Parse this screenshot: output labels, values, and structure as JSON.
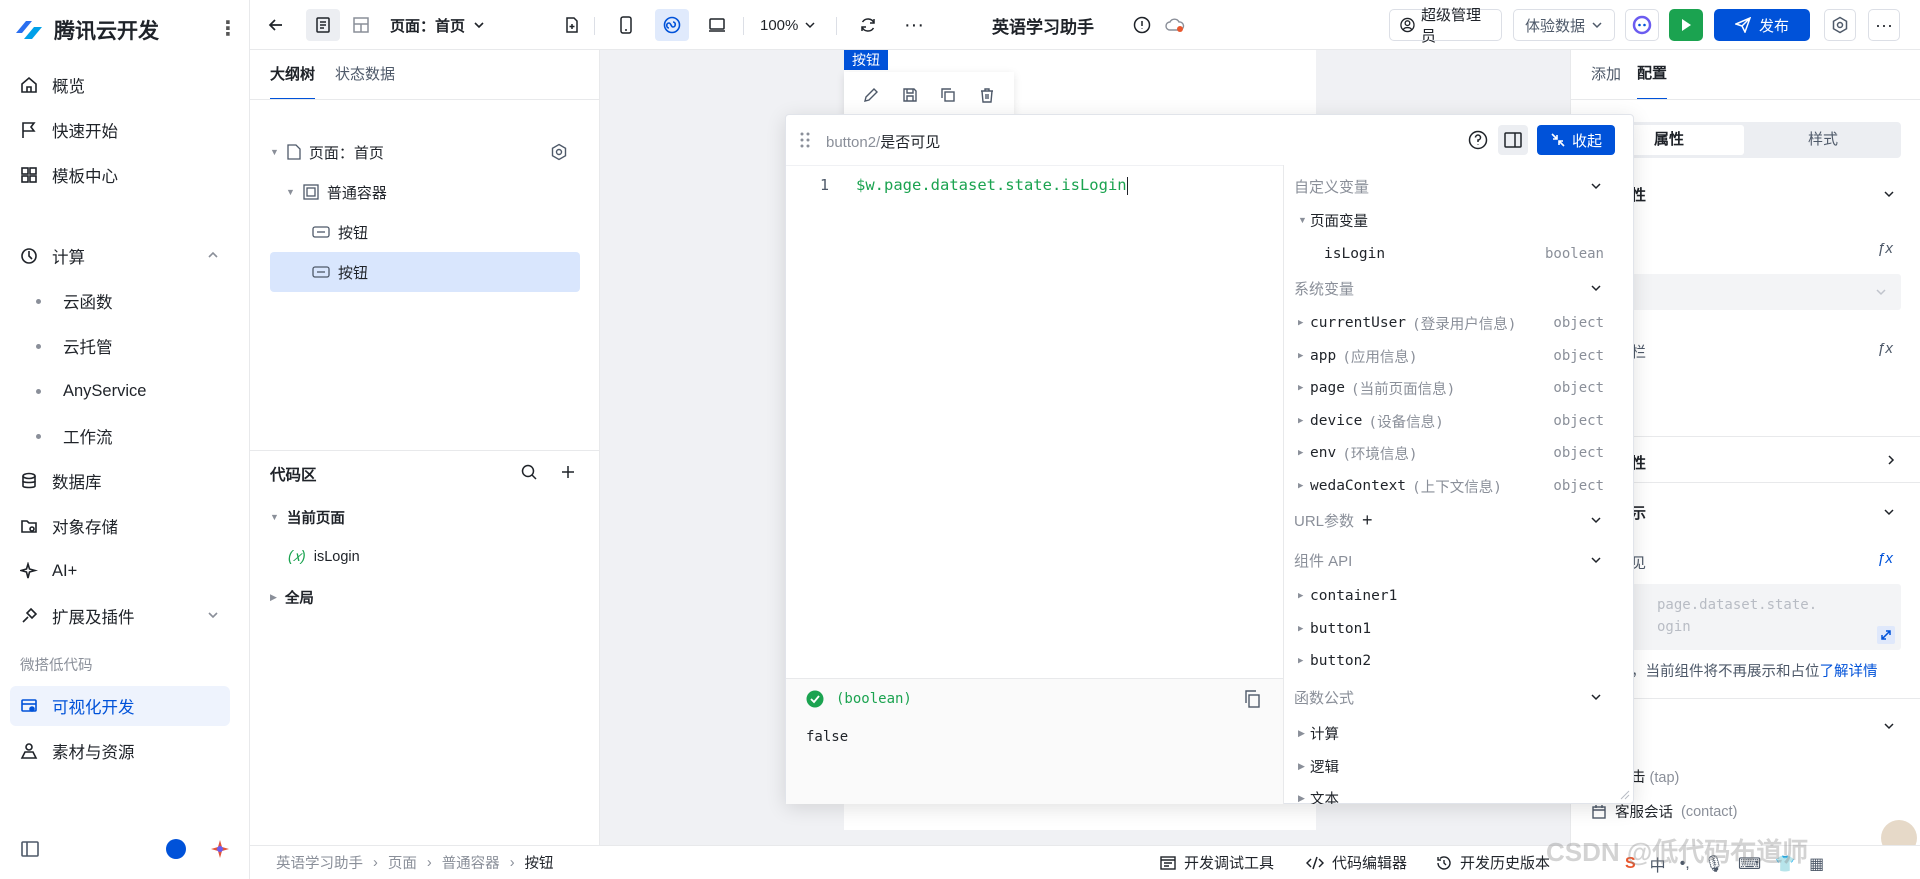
{
  "sidebar": {
    "brand": "腾讯云开发",
    "items": [
      {
        "label": "概览"
      },
      {
        "label": "快速开始"
      },
      {
        "label": "模板中心"
      },
      {
        "label": "计算"
      },
      {
        "label": "云函数"
      },
      {
        "label": "云托管"
      },
      {
        "label": "AnyService"
      },
      {
        "label": "工作流"
      },
      {
        "label": "数据库"
      },
      {
        "label": "对象存储"
      },
      {
        "label": "AI+"
      },
      {
        "label": "扩展及插件"
      }
    ],
    "group_label": "微搭低代码",
    "lowcode_items": [
      {
        "label": "可视化开发"
      },
      {
        "label": "素材与资源"
      }
    ]
  },
  "topbar": {
    "page_label": "页面：首页",
    "zoom": "100%",
    "app_title": "英语学习助手",
    "admin": "超级管理员",
    "data_mode": "体验数据",
    "publish": "发布"
  },
  "outline": {
    "tabs": [
      "大纲树",
      "状态数据"
    ],
    "tree": [
      "页面：首页",
      "普通容器",
      "按钮",
      "按钮"
    ]
  },
  "codearea": {
    "title": "代码区",
    "current_page": "当前页面",
    "var_icon": "(𝑥)",
    "var_name": "isLogin",
    "global": "全局"
  },
  "canvas": {
    "component_tag": "按钮"
  },
  "popup": {
    "path_prefix": "button2/",
    "path_name": "是否可见",
    "collapse": "收起",
    "line_no": "1",
    "code": "$w.page.dataset.state.isLogin",
    "result_type": "(boolean)",
    "result_value": "false",
    "sections": {
      "custom_vars": "自定义变量",
      "page_vars": "页面变量",
      "system_vars": "系统变量",
      "url_params": "URL参数",
      "component_api": "组件 API",
      "functions": "函数公式"
    },
    "page_var": {
      "name": "isLogin",
      "type": "boolean"
    },
    "system_vars": [
      {
        "name": "currentUser",
        "cn": "(登录用户信息)",
        "type": "object"
      },
      {
        "name": "app",
        "cn": "(应用信息)",
        "type": "object"
      },
      {
        "name": "page",
        "cn": "(当前页面信息)",
        "type": "object"
      },
      {
        "name": "device",
        "cn": "(设备信息)",
        "type": "object"
      },
      {
        "name": "env",
        "cn": "(环境信息)",
        "type": "object"
      },
      {
        "name": "wedaContext",
        "cn": "(上下文信息)",
        "type": "object"
      }
    ],
    "components": [
      "container1",
      "button1",
      "button2"
    ],
    "functions": [
      "计算",
      "逻辑",
      "文本"
    ]
  },
  "rightpanel": {
    "tabs": [
      "添加",
      "配置"
    ],
    "seg": [
      "属性",
      "样式"
    ],
    "sec1": "性",
    "row_lan": "栏",
    "sec2": "性",
    "sec3": "示",
    "visible": "见",
    "code_preview": "page.dataset.state.\nogin",
    "hint": "，当前组件将不再展示和占位",
    "hint_link": "了解详情",
    "event_tap": "击",
    "event_tap_en": "(tap)",
    "event_contact": "客服会话",
    "event_contact_en": "(contact)"
  },
  "bottombar": {
    "breadcrumb": [
      "英语学习助手",
      "页面",
      "普通容器",
      "按钮"
    ],
    "dev_tools": "开发调试工具",
    "code_editor": "代码编辑器",
    "history": "开发历史版本"
  },
  "watermark": "CSDN @低代码布道师",
  "colors": {
    "accent": "#0052d9",
    "green": "#1ba350",
    "selected": "#d9e6fd"
  }
}
